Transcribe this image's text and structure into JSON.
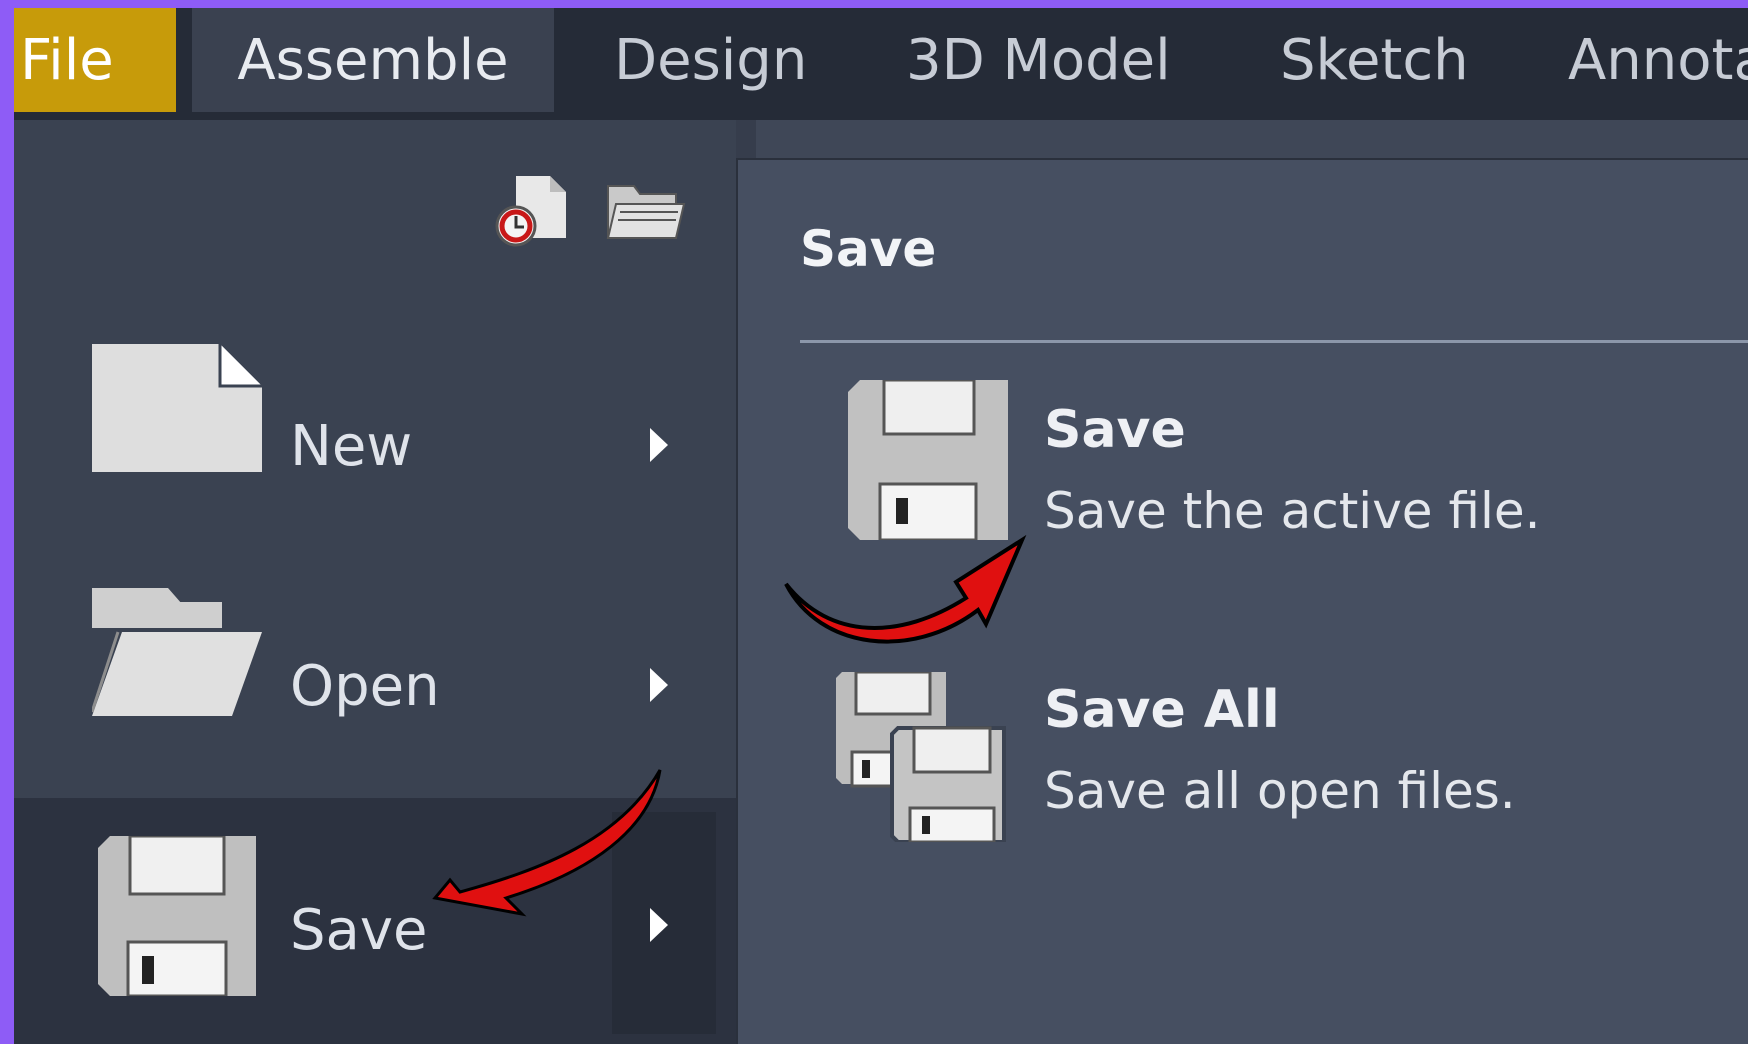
{
  "ribbon": {
    "tabs": [
      {
        "label": "File",
        "active": true
      },
      {
        "label": "Assemble"
      },
      {
        "label": "Design"
      },
      {
        "label": "3D Model"
      },
      {
        "label": "Sketch"
      },
      {
        "label": "Annota"
      }
    ]
  },
  "file_menu": {
    "quick_icons": [
      "recent-documents-icon",
      "open-folder-icon"
    ],
    "items": [
      {
        "label": "New",
        "icon": "new-document-icon"
      },
      {
        "label": "Open",
        "icon": "folder-icon"
      },
      {
        "label": "Save",
        "icon": "floppy-disk-icon",
        "selected": true
      }
    ]
  },
  "submenu": {
    "title": "Save",
    "items": [
      {
        "title": "Save",
        "description": "Save the active file.",
        "icon": "floppy-disk-icon"
      },
      {
        "title": "Save All",
        "description": "Save all open files.",
        "icon": "multiple-floppy-disks-icon"
      }
    ]
  },
  "annotations": {
    "arrow_color": "#e01010"
  },
  "colors": {
    "file_tab": "#c79b0a",
    "frame": "#8e5cf6",
    "ribbon": "#252b37",
    "menu_bg": "#3a4251",
    "submenu_bg": "#464f61"
  }
}
